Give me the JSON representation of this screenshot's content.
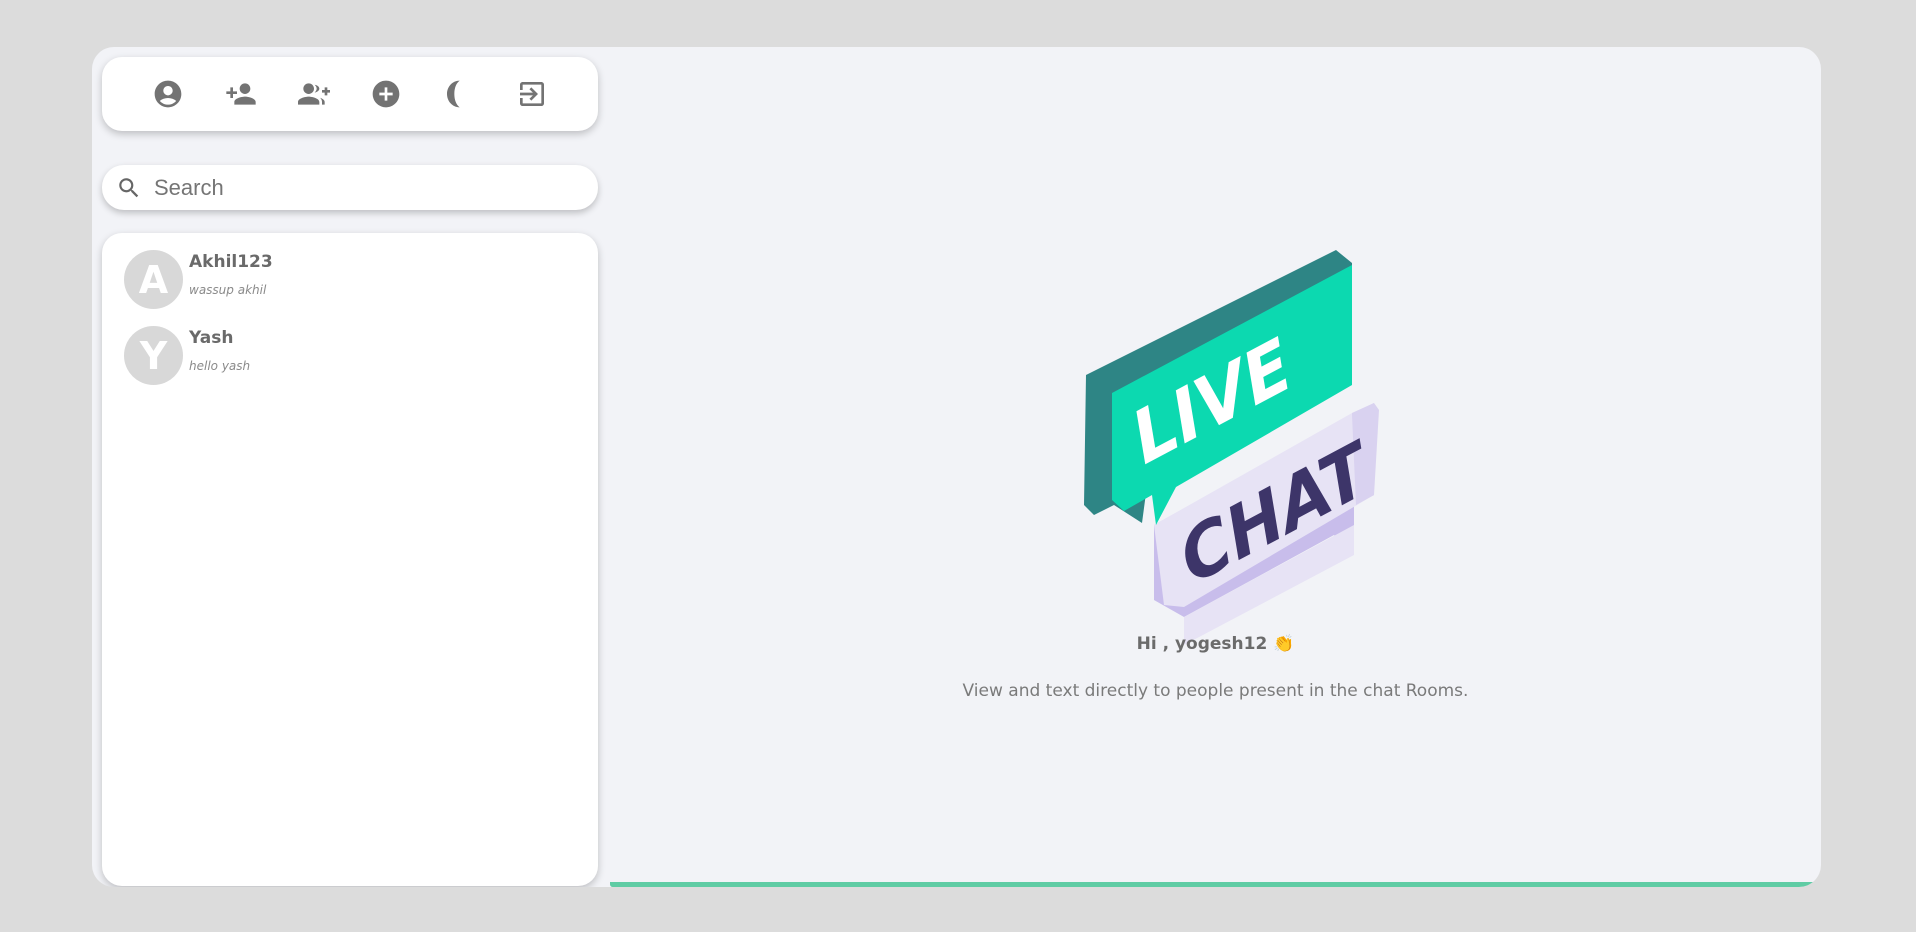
{
  "toolbar": {
    "buttons": [
      {
        "icon": "account-circle-icon",
        "label": "Profile"
      },
      {
        "icon": "person-add-icon",
        "label": "Add friend"
      },
      {
        "icon": "group-add-icon",
        "label": "Create group"
      },
      {
        "icon": "add-circle-icon",
        "label": "New chat"
      },
      {
        "icon": "moon-icon",
        "label": "Dark mode"
      },
      {
        "icon": "logout-icon",
        "label": "Logout"
      }
    ],
    "icon_color": "#737373"
  },
  "search": {
    "placeholder": "Search",
    "value": ""
  },
  "contacts": [
    {
      "initial": "A",
      "name": "Akhil123",
      "last_message": "wassup akhil"
    },
    {
      "initial": "Y",
      "name": "Yash",
      "last_message": "hello yash"
    }
  ],
  "welcome": {
    "logo_word_1": "LIVE",
    "logo_word_2": "CHAT",
    "greeting": "Hi , yogesh12",
    "greeting_emoji": "👏",
    "subtitle": "View and text directly to people present in the chat Rooms."
  },
  "colors": {
    "background": "#dcdcdc",
    "panel": "#f2f3f7",
    "accent": "#5fcca4",
    "bubble_green": "#0cd9b0",
    "bubble_dark_green": "#2e8585",
    "bubble_lavender": "#e7e3f5",
    "chat_text": "#3d3569"
  }
}
